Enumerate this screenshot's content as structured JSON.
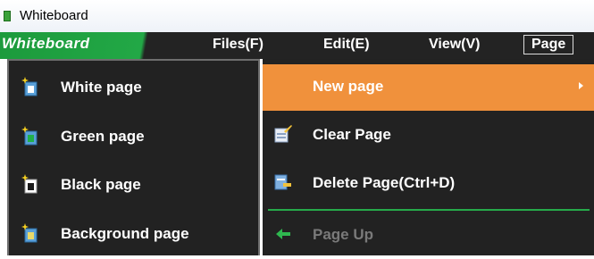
{
  "window": {
    "title": "Whiteboard"
  },
  "menubar": {
    "brand": "Whiteboard",
    "items": [
      {
        "label": "Files(F)"
      },
      {
        "label": "Edit(E)"
      },
      {
        "label": "View(V)"
      },
      {
        "label": "Page",
        "active": true
      }
    ]
  },
  "new_page_submenu": {
    "items": [
      {
        "label": "White page",
        "icon": "new-white-page-icon",
        "color": "#ffffff"
      },
      {
        "label": "Green page",
        "icon": "new-green-page-icon",
        "color": "#22b04a"
      },
      {
        "label": "Black page",
        "icon": "new-black-page-icon",
        "color": "#1a1a1a"
      },
      {
        "label": "Background page",
        "icon": "new-background-page-icon",
        "color": "#e8d96a"
      }
    ]
  },
  "page_menu": {
    "items": [
      {
        "label": "New page",
        "highlighted": true,
        "has_submenu": true
      },
      {
        "label": "Clear Page",
        "icon": "clear-page-icon"
      },
      {
        "label": "Delete Page(Ctrl+D)",
        "icon": "delete-page-icon"
      },
      {
        "label": "Page Up",
        "icon": "page-up-arrow-icon",
        "disabled": true
      }
    ]
  },
  "colors": {
    "menu_bg": "#232323",
    "highlight": "#f0913c",
    "brand_green": "#22a846",
    "separator": "#26aa4a"
  }
}
